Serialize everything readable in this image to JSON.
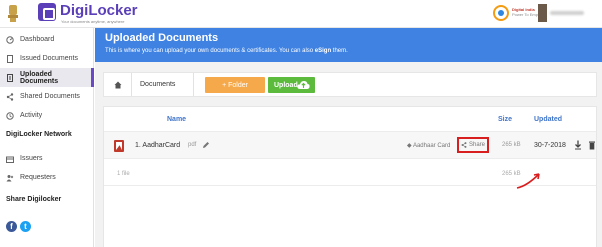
{
  "header": {
    "brand": "DigiLocker",
    "tagline": "Your documents anytime, anywhere",
    "partner_logo_text": "Digital India",
    "partner_tagline": "Power To Empower"
  },
  "sidebar": {
    "items": [
      {
        "label": "Dashboard",
        "icon": "dashboard-icon"
      },
      {
        "label": "Issued Documents",
        "icon": "document-icon"
      },
      {
        "label": "Uploaded Documents",
        "icon": "upload-document-icon",
        "active": true
      },
      {
        "label": "Shared Documents",
        "icon": "share-icon"
      },
      {
        "label": "Activity",
        "icon": "activity-icon"
      }
    ],
    "network_title": "DigiLocker Network",
    "network_items": [
      {
        "label": "Issuers",
        "icon": "issuers-icon"
      },
      {
        "label": "Requesters",
        "icon": "requesters-icon"
      }
    ],
    "share_title": "Share Digilocker",
    "social": [
      {
        "name": "facebook",
        "glyph": "f",
        "color": "#3b5998"
      },
      {
        "name": "twitter",
        "glyph": "t",
        "color": "#1da1f2"
      }
    ]
  },
  "main": {
    "title": "Uploaded Documents",
    "subtitle_before": "This is where you can upload your own documents & certificates. You can also ",
    "subtitle_bold": "eSign",
    "subtitle_after": " them.",
    "breadcrumb": "Documents",
    "folder_button": "+ Folder",
    "upload_button": "Upload",
    "columns": {
      "name": "Name",
      "size": "Size",
      "updated": "Updated"
    },
    "file": {
      "name": "1. AadharCard",
      "ext": "pdf",
      "tag": "Aadhaar Card",
      "share_label": "Share",
      "size": "265 kB",
      "updated": "30-7-2018"
    },
    "file_count": "1 file",
    "total_size": "265 kB"
  },
  "colors": {
    "brand": "#5a3fb8",
    "hero": "#3f82e2",
    "folder_button": "#f5a94a",
    "upload_button": "#5cba3c",
    "highlight": "#d81e1e"
  }
}
